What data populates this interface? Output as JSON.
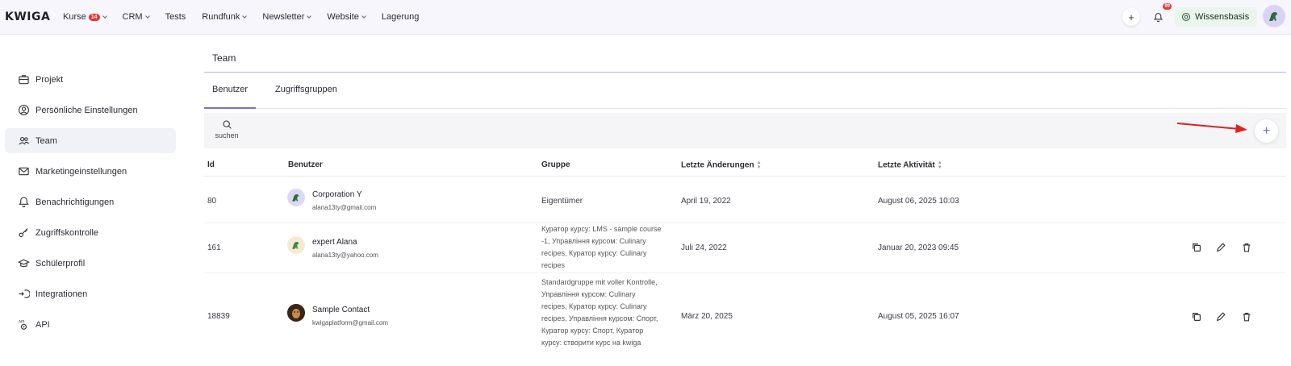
{
  "app": {
    "logo": "KWIGA"
  },
  "nav": {
    "items": [
      {
        "label": "Kurse",
        "badge": "14",
        "dropdown": true
      },
      {
        "label": "CRM",
        "dropdown": true
      },
      {
        "label": "Tests",
        "dropdown": false
      },
      {
        "label": "Rundfunk",
        "dropdown": true
      },
      {
        "label": "Newsletter",
        "dropdown": true
      },
      {
        "label": "Website",
        "dropdown": true
      },
      {
        "label": "Lagerung",
        "dropdown": false
      }
    ],
    "plus_icon": "plus-icon",
    "bell_badge": "99",
    "help_label": "Wissensbasis"
  },
  "sidebar": {
    "items": [
      {
        "label": "Projekt",
        "icon": "briefcase-icon"
      },
      {
        "label": "Persönliche Einstellungen",
        "icon": "user-circle-icon"
      },
      {
        "label": "Team",
        "icon": "users-icon",
        "active": true
      },
      {
        "label": "Marketingeinstellungen",
        "icon": "mail-icon"
      },
      {
        "label": "Benachrichtigungen",
        "icon": "bell-icon"
      },
      {
        "label": "Zugriffskontrolle",
        "icon": "key-icon"
      },
      {
        "label": "Schülerprofil",
        "icon": "graduation-cap-icon"
      },
      {
        "label": "Integrationen",
        "icon": "integration-icon"
      },
      {
        "label": "API",
        "icon": "api-gear-icon"
      }
    ]
  },
  "main": {
    "title": "Team",
    "tabs": [
      {
        "label": "Benutzer",
        "active": true
      },
      {
        "label": "Zugriffsgruppen",
        "active": false
      }
    ],
    "search_label": "suchen"
  },
  "table": {
    "headers": {
      "id": "Id",
      "user": "Benutzer",
      "group": "Gruppe",
      "changed": "Letzte Änderungen",
      "activity": "Letzte Aktivität"
    },
    "rows": [
      {
        "id": "80",
        "name": "Corporation Y",
        "email": "alana13ty@gmail.com",
        "group": "Eigentümer",
        "changed": "April 19, 2022",
        "activity": "August 06, 2025 10:03",
        "actions": false
      },
      {
        "id": "161",
        "name": "expert Alana",
        "email": "alana13ty@yahoo.com",
        "group": "Куратор курсу: LMS - sample course -1, Управління курсом: Culinary recipes, Куратор курсу: Culinary recipes",
        "changed": "Juli 24, 2022",
        "activity": "Januar 20, 2023 09:45",
        "actions": true
      },
      {
        "id": "18839",
        "name": "Sample Contact",
        "email": "kwigaplatform@gmail.com",
        "group": "Standardgruppe mit voller Kontrolle, Управління курсом: Culinary recipes, Куратор курсу: Culinary recipes, Управління курсом: Спорт, Куратор курсу: Спорт, Куратор курсу: створити курс на kwiga",
        "changed": "März 20, 2025",
        "activity": "August 05, 2025 16:07",
        "actions": true
      }
    ]
  },
  "colors": {
    "accent": "#7a6fe0",
    "badge": "#e33333",
    "annotation_arrow": "#e02020"
  }
}
